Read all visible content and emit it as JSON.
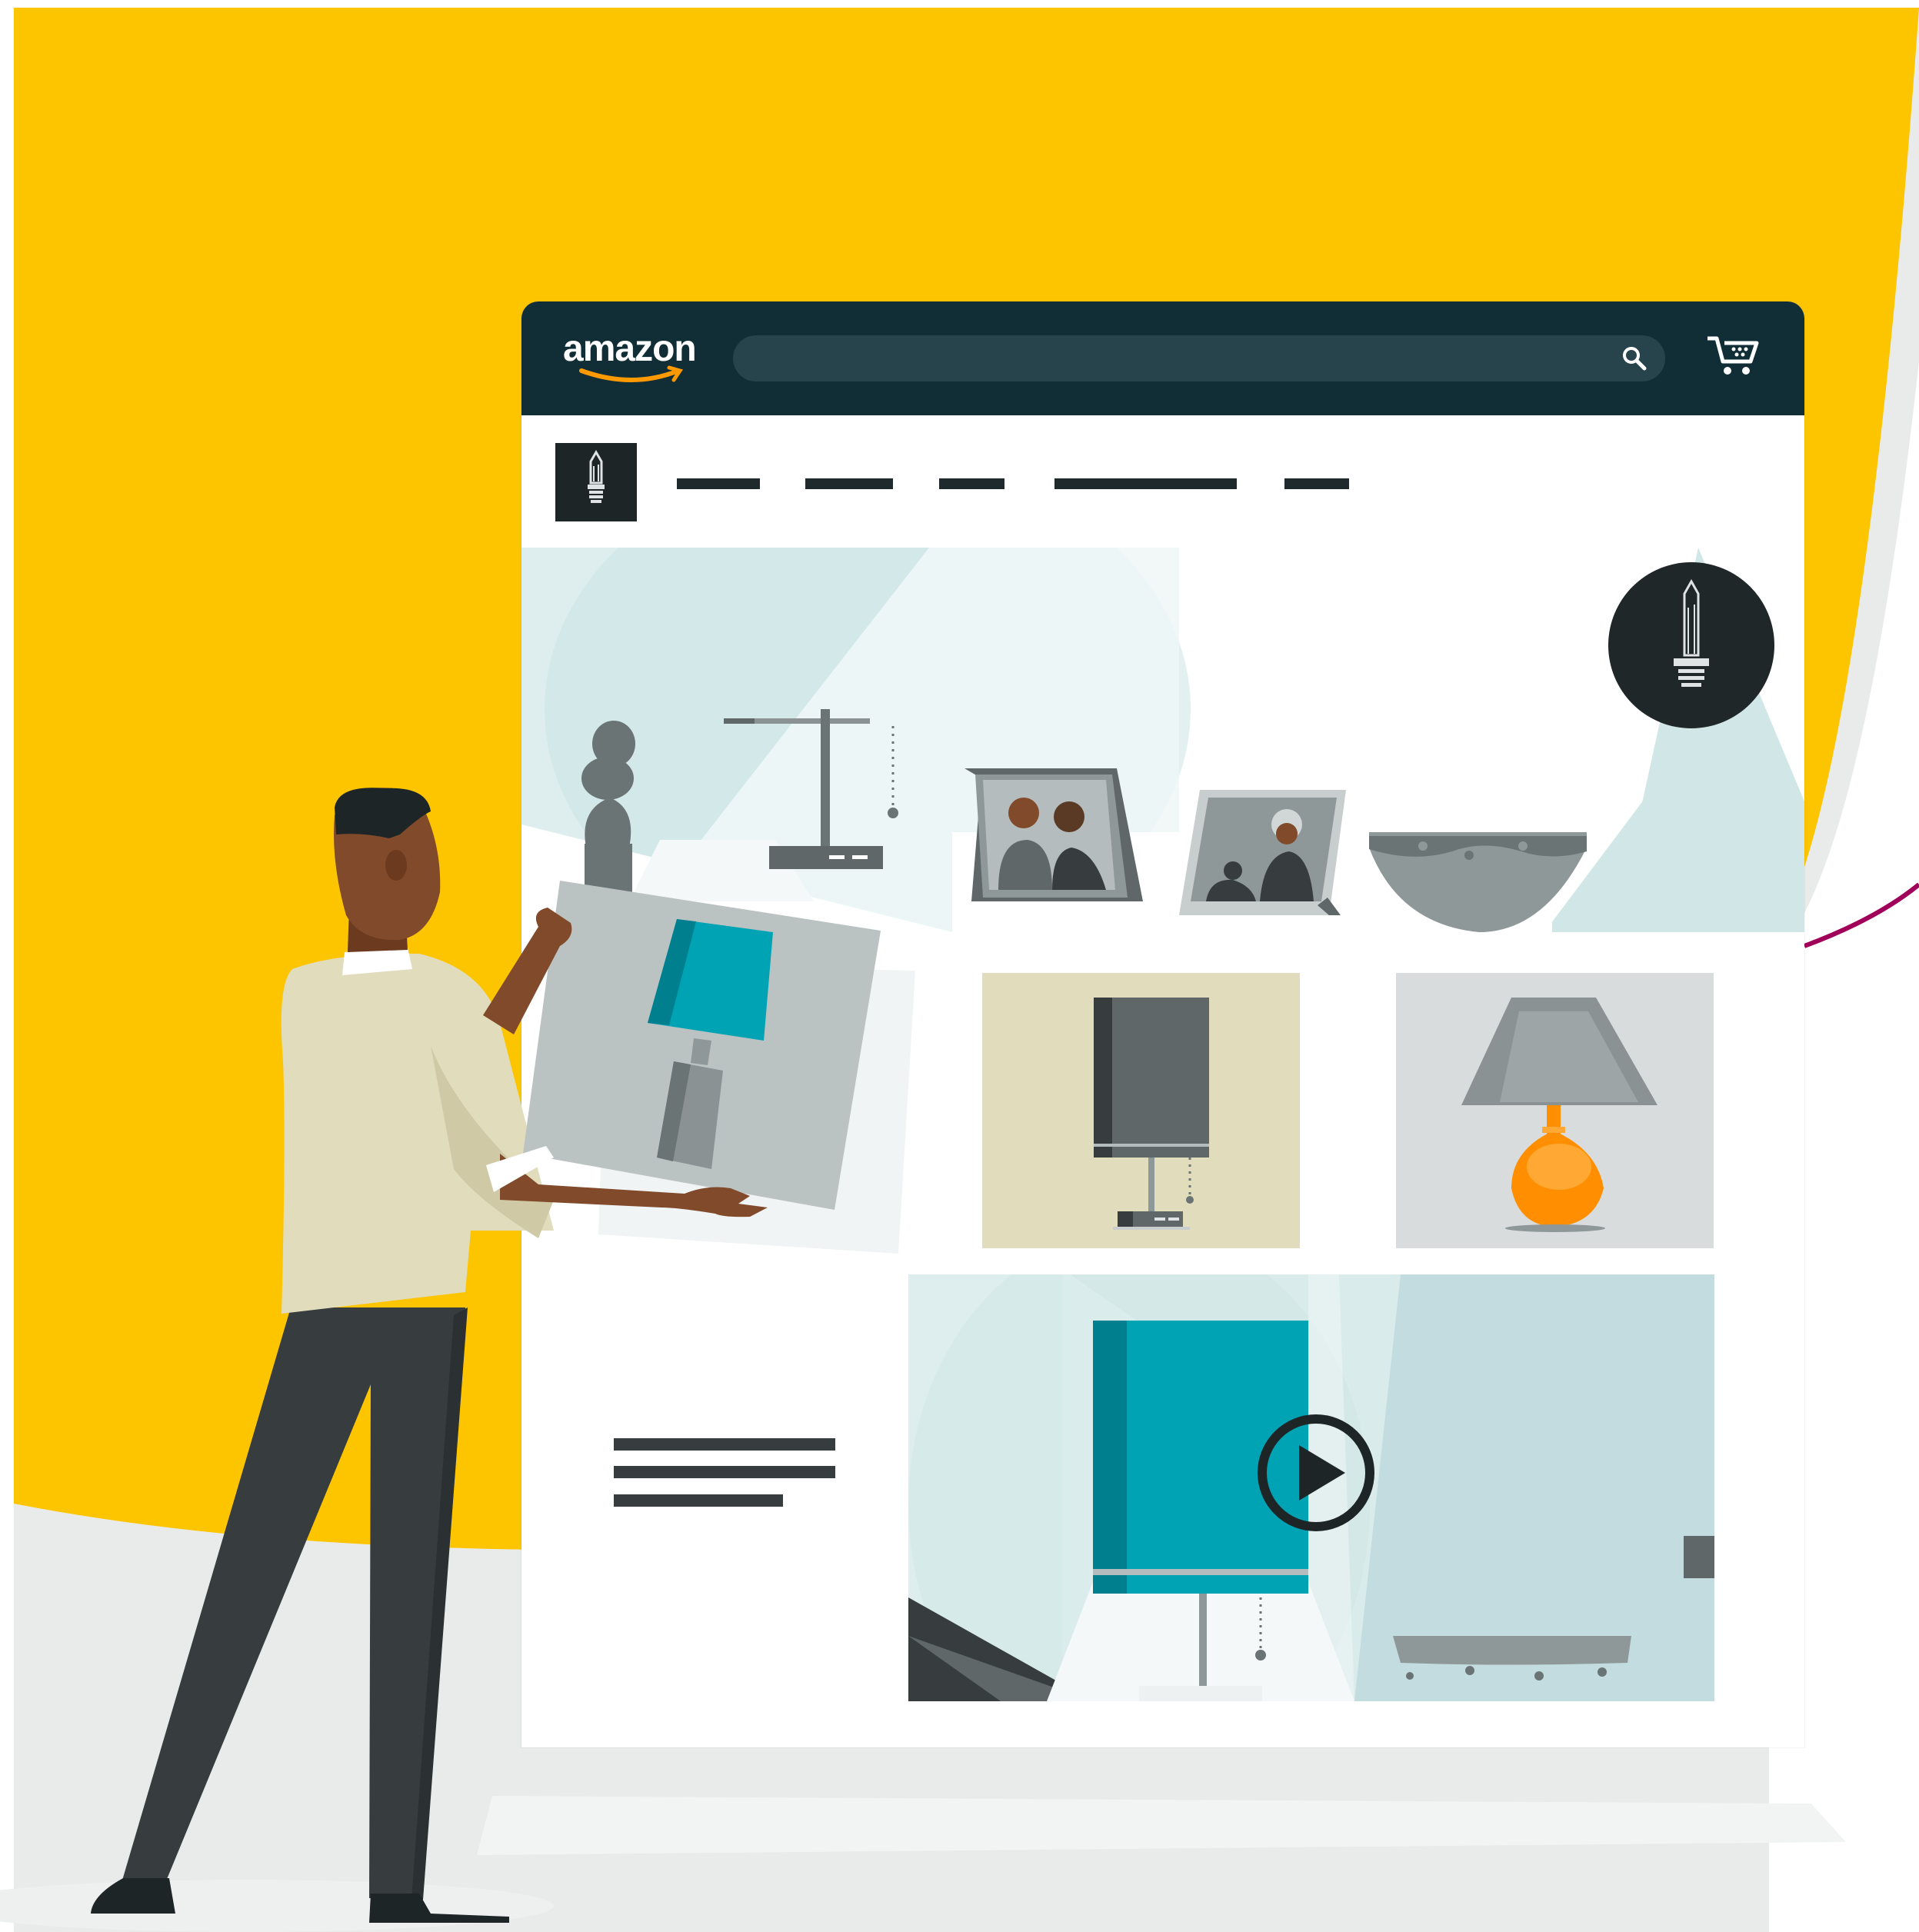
{
  "colors": {
    "yellow": "#fdc400",
    "navy": "#112e37",
    "search_bg": "#27444d",
    "teal": "#00a3b4",
    "orange": "#ff8f00",
    "dark": "#373d3f",
    "magenta": "#a0005a"
  },
  "browser": {
    "logo_text": "amazon",
    "search": {
      "placeholder": "",
      "value": ""
    },
    "icons": [
      "search-icon",
      "cart-icon"
    ]
  },
  "store": {
    "logo_icon": "light-bulb-icon",
    "nav_items": [
      "",
      "",
      "",
      "",
      ""
    ]
  },
  "hero": {
    "badge_icon": "light-bulb-icon",
    "products": [
      "sculpture",
      "desk-lamp",
      "photo-frame",
      "photo-frame",
      "bowl"
    ]
  },
  "grid": {
    "tiles": [
      "table-lamp-teal",
      "floor-lamp-dark",
      "table-lamp-orange"
    ]
  },
  "video": {
    "play_icon": "play-icon"
  },
  "person": {
    "holding": "table-lamp-teal"
  }
}
